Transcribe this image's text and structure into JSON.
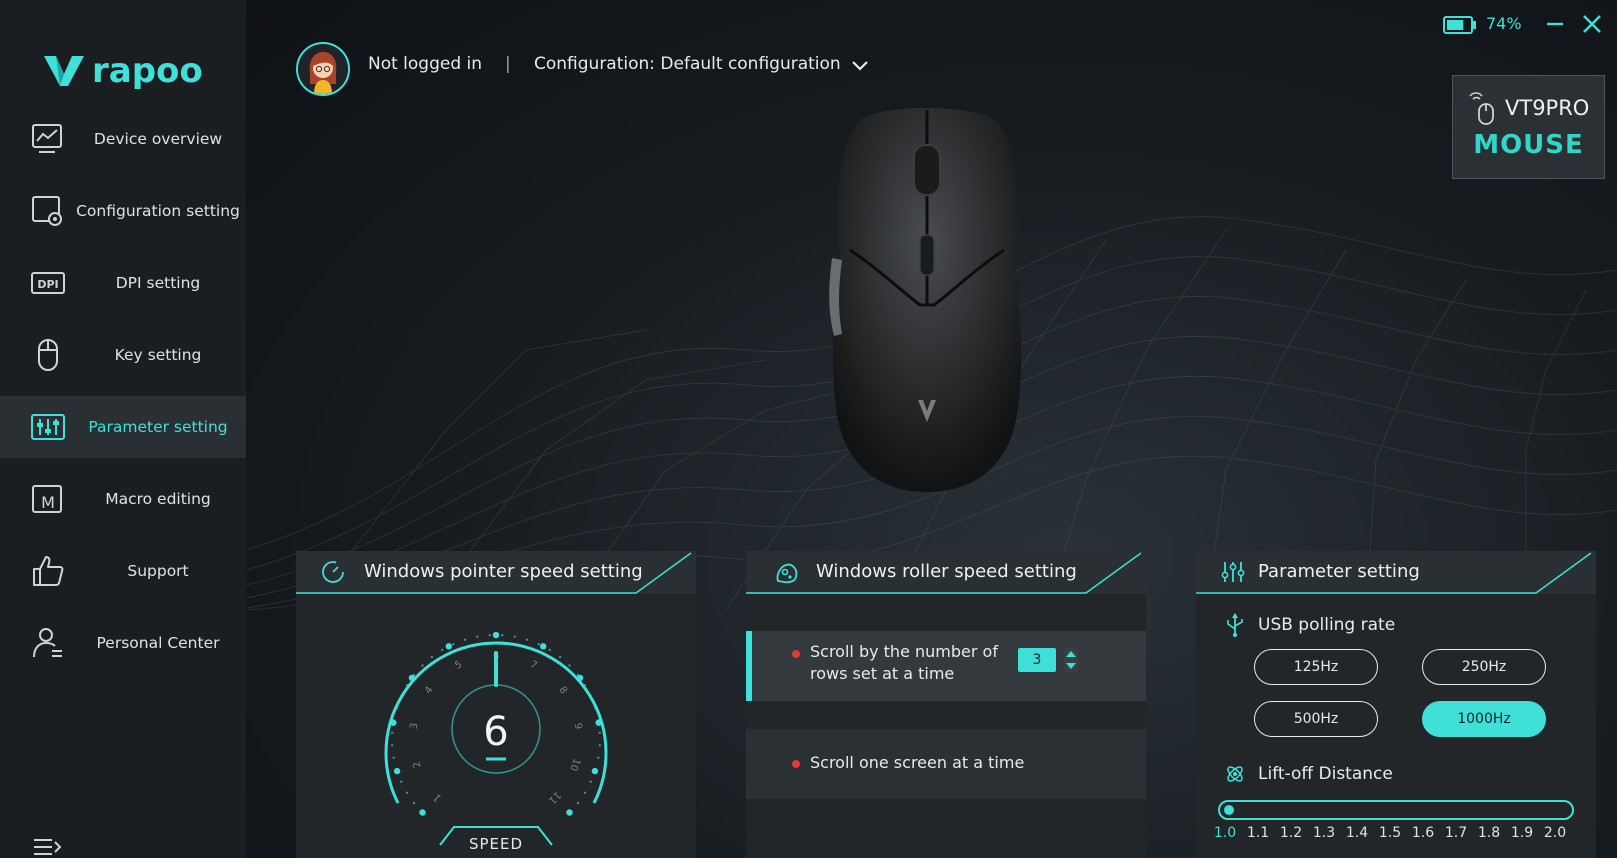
{
  "brand": {
    "name": "rapoo",
    "accent": "#3ee0d8"
  },
  "sidebar": {
    "items": [
      {
        "label": "Device overview",
        "icon": "chart-monitor-icon",
        "active": false
      },
      {
        "label": "Configuration setting",
        "icon": "config-gear-icon",
        "active": false
      },
      {
        "label": "DPI setting",
        "icon": "dpi-icon",
        "active": false
      },
      {
        "label": "Key setting",
        "icon": "mouse-icon",
        "active": false
      },
      {
        "label": "Parameter setting",
        "icon": "sliders-icon",
        "active": true
      },
      {
        "label": "Macro editing",
        "icon": "macro-icon",
        "active": false
      },
      {
        "label": "Support",
        "icon": "thumbs-up-icon",
        "active": false
      },
      {
        "label": "Personal Center",
        "icon": "user-icon",
        "active": false
      }
    ]
  },
  "header": {
    "user_status": "Not logged in",
    "separator": "|",
    "configuration": "Configuration: Default configuration"
  },
  "window": {
    "battery": "74%",
    "battery_level": 0.74
  },
  "device": {
    "name": "VT9PRO",
    "type": "MOUSE"
  },
  "pointer_panel": {
    "title": "Windows pointer speed setting",
    "speed_value": "6",
    "speed_label": "SPEED",
    "scale": [
      "1",
      "2",
      "3",
      "4",
      "5",
      "6",
      "7",
      "8",
      "9",
      "10",
      "11"
    ]
  },
  "roller_panel": {
    "title": "Windows roller speed setting",
    "option_rows": "Scroll by the number of rows set at a time",
    "option_rows_line1": "Scroll by the number of",
    "option_rows_line2": "rows set at a time",
    "rows_value": "3",
    "option_screen": "Scroll one screen at a time"
  },
  "parameter_panel": {
    "title": "Parameter setting",
    "polling_label": "USB polling rate",
    "polling_rates": [
      "125Hz",
      "250Hz",
      "500Hz",
      "1000Hz"
    ],
    "polling_selected": "1000Hz",
    "liftoff_label": "Lift-off Distance",
    "liftoff_ticks": [
      "1.0",
      "1.1",
      "1.2",
      "1.3",
      "1.4",
      "1.5",
      "1.6",
      "1.7",
      "1.8",
      "1.9",
      "2.0"
    ],
    "liftoff_value": "1.0"
  }
}
